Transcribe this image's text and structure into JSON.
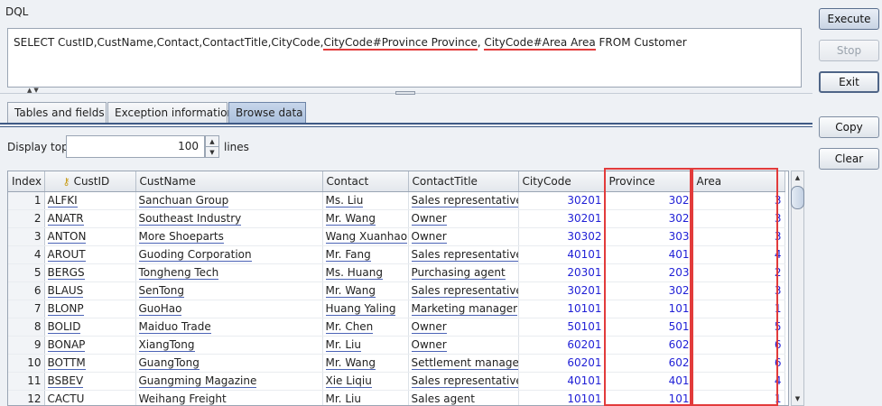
{
  "dql": {
    "label": "DQL",
    "query_parts": {
      "p1": "SELECT CustID,CustName,Contact,ContactTitle,CityCode,",
      "p2": "CityCode#Province Province",
      "p3": ", ",
      "p4": "CityCode#Area Area",
      "p5": " FROM Customer"
    }
  },
  "buttons": {
    "execute": "Execute",
    "stop": "Stop",
    "exit": "Exit",
    "copy": "Copy",
    "clear": "Clear"
  },
  "tabs": [
    {
      "label": "Tables and fields"
    },
    {
      "label": "Exception information"
    },
    {
      "label": "Browse data",
      "active": true
    }
  ],
  "display": {
    "label": "Display top",
    "value": "100",
    "suffix": "lines"
  },
  "grid": {
    "columns": [
      "Index",
      "CustID",
      "CustName",
      "Contact",
      "ContactTitle",
      "CityCode",
      "Province",
      "Area"
    ],
    "rows": [
      [
        "1",
        "ALFKI",
        "Sanchuan Group",
        "Ms. Liu",
        "Sales representative",
        "30201",
        "302",
        "3"
      ],
      [
        "2",
        "ANATR",
        "Southeast Industry",
        "Mr. Wang",
        "Owner",
        "30201",
        "302",
        "3"
      ],
      [
        "3",
        "ANTON",
        "More Shoeparts",
        "Wang Xuanhao",
        "Owner",
        "30302",
        "303",
        "3"
      ],
      [
        "4",
        "AROUT",
        "Guoding Corporation",
        "Mr. Fang",
        "Sales representative",
        "40101",
        "401",
        "4"
      ],
      [
        "5",
        "BERGS",
        "Tongheng Tech",
        "Ms. Huang",
        "Purchasing agent",
        "20301",
        "203",
        "2"
      ],
      [
        "6",
        "BLAUS",
        "SenTong",
        "Mr. Wang",
        "Sales representative",
        "30201",
        "302",
        "3"
      ],
      [
        "7",
        "BLONP",
        "GuoHao",
        "Huang Yaling",
        "Marketing manager",
        "10101",
        "101",
        "1"
      ],
      [
        "8",
        "BOLID",
        "Maiduo Trade",
        "Mr. Chen",
        "Owner",
        "50101",
        "501",
        "5"
      ],
      [
        "9",
        "BONAP",
        "XiangTong",
        "Mr. Liu",
        "Owner",
        "60201",
        "602",
        "6"
      ],
      [
        "10",
        "BOTTM",
        "GuangTong",
        "Mr. Wang",
        "Settlement manager",
        "60201",
        "602",
        "6"
      ],
      [
        "11",
        "BSBEV",
        "Guangming Magazine",
        "Xie Liqiu",
        "Sales representative",
        "40101",
        "401",
        "4"
      ],
      [
        "12",
        "CACTU",
        "Weihang Freight",
        "Mr. Liu",
        "Sales agent",
        "10101",
        "101",
        "1"
      ]
    ]
  },
  "icons": {
    "key": "key-icon",
    "scroll_up": "arrow-up-icon",
    "scroll_down": "arrow-down-icon",
    "spin_up": "arrow-up-icon",
    "spin_down": "arrow-down-icon"
  },
  "colors": {
    "highlight": "#e23b3b",
    "number_text": "#1f1fd6",
    "tab_active": "#a9bfdc"
  }
}
